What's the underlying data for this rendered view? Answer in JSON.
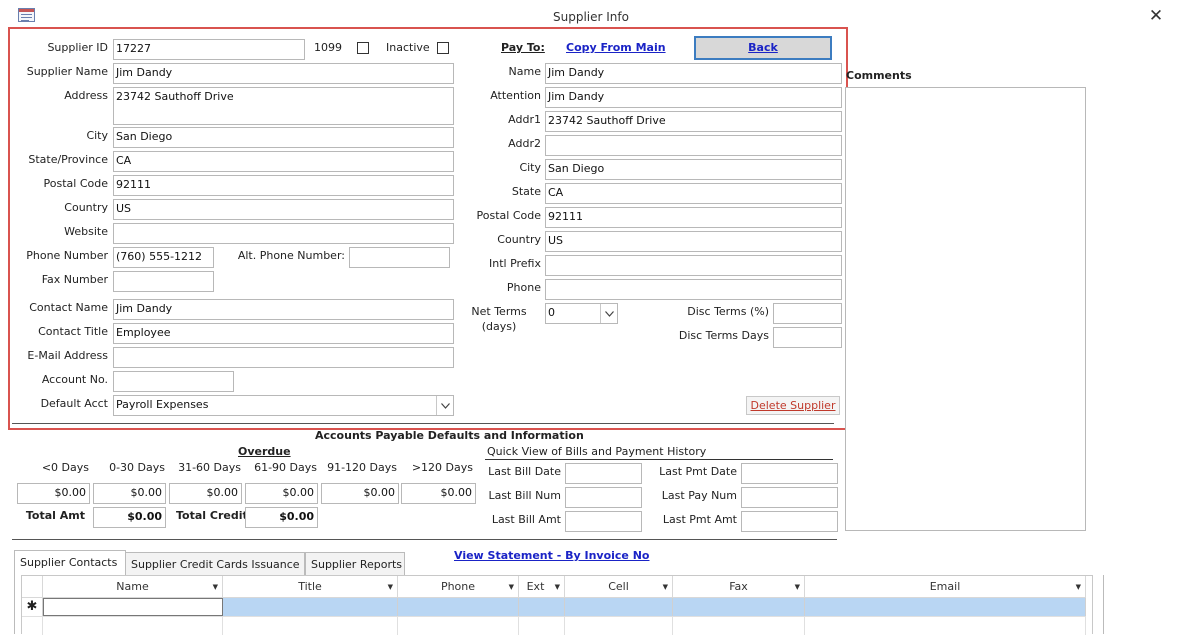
{
  "window": {
    "title": "Supplier Info"
  },
  "supplier": {
    "labels": {
      "id": "Supplier ID",
      "n1099": "1099",
      "inactive": "Inactive",
      "name": "Supplier Name",
      "address": "Address",
      "city": "City",
      "state": "State/Province",
      "postal": "Postal Code",
      "country": "Country",
      "website": "Website",
      "phone": "Phone Number",
      "alt_phone": "Alt. Phone Number:",
      "fax": "Fax Number",
      "contact_name": "Contact Name",
      "contact_title": "Contact Title",
      "email": "E-Mail Address",
      "account": "Account No.",
      "default_acct": "Default Acct"
    },
    "values": {
      "id": "17227",
      "name": "Jim Dandy",
      "address": "23742 Sauthoff Drive",
      "city": "San Diego",
      "state": "CA",
      "postal": "92111",
      "country": "US",
      "website": "",
      "phone": "(760) 555-1212",
      "alt_phone": "",
      "fax": "",
      "contact_name": "Jim Dandy",
      "contact_title": "Employee",
      "email": "",
      "account": "",
      "default_acct": "Payroll Expenses"
    }
  },
  "payto": {
    "heading": "Pay To:",
    "copy_link": "Copy From Main",
    "back_label": "Back",
    "labels": {
      "name": "Name",
      "attention": "Attention",
      "addr1": "Addr1",
      "addr2": "Addr2",
      "city": "City",
      "state": "State",
      "postal": "Postal Code",
      "country": "Country",
      "intl": "Intl Prefix",
      "phone": "Phone",
      "net_terms_1": "Net Terms",
      "net_terms_2": "(days)",
      "disc_pct": "Disc Terms (%)",
      "disc_days": "Disc Terms Days"
    },
    "values": {
      "name": "Jim Dandy",
      "attention": "Jim Dandy",
      "addr1": "23742 Sauthoff Drive",
      "addr2": "",
      "city": "San Diego",
      "state": "CA",
      "postal": "92111",
      "country": "US",
      "intl": "",
      "phone": "",
      "net_terms": "0",
      "disc_pct": "",
      "disc_days": ""
    },
    "delete_label": "Delete Supplier"
  },
  "comments": {
    "label": "Comments"
  },
  "ap": {
    "title": "Accounts Payable Defaults and Information",
    "overdue": "Overdue",
    "buckets": [
      "<0 Days",
      "0-30 Days",
      "31-60 Days",
      "61-90 Days",
      "91-120 Days",
      ">120 Days"
    ],
    "amounts": [
      "$0.00",
      "$0.00",
      "$0.00",
      "$0.00",
      "$0.00",
      "$0.00"
    ],
    "total_amt_label": "Total Amt",
    "total_amt": "$0.00",
    "total_credit_label": "Total Credit",
    "total_credit": "$0.00"
  },
  "quick": {
    "title": "Quick View of Bills and Payment History",
    "last_bill_date": "Last Bill Date",
    "last_bill_num": "Last Bill Num",
    "last_bill_amt": "Last Bill Amt",
    "last_pmt_date": "Last Pmt Date",
    "last_pay_num": "Last Pay Num",
    "last_pmt_amt": "Last Pmt Amt"
  },
  "statement_link": "View Statement - By Invoice No",
  "tabs": [
    "Supplier Contacts",
    "Supplier Credit Cards Issuance",
    "Supplier Reports"
  ],
  "grid": {
    "columns": [
      "Name",
      "Title",
      "Phone",
      "Ext",
      "Cell",
      "Fax",
      "Email"
    ],
    "new_row_marker": "✱"
  },
  "icons": {
    "close": "close-icon",
    "dropdown": "chevron-down-icon",
    "app": "form-icon"
  },
  "colors": {
    "highlight": "#d9534f",
    "link": "#1a23c6",
    "delete": "#c0392b",
    "selection": "#b9d6f3"
  }
}
